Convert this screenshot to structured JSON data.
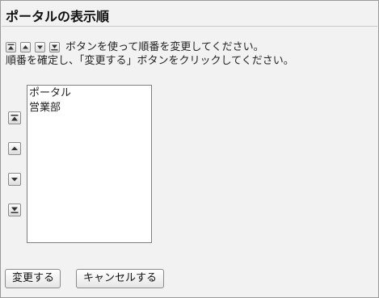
{
  "page": {
    "title": "ポータルの表示順",
    "instruction_line1": "ボタンを使って順番を変更してください。",
    "instruction_line2": "順番を確定し、「変更する」ボタンをクリックしてください。"
  },
  "order_buttons": {
    "top_icon": "move-to-top-icon",
    "up_icon": "move-up-icon",
    "down_icon": "move-down-icon",
    "bottom_icon": "move-to-bottom-icon"
  },
  "list": {
    "items": [
      "ポータル",
      "営業部"
    ]
  },
  "actions": {
    "change_label": "変更する",
    "cancel_label": "キャンセルする"
  }
}
